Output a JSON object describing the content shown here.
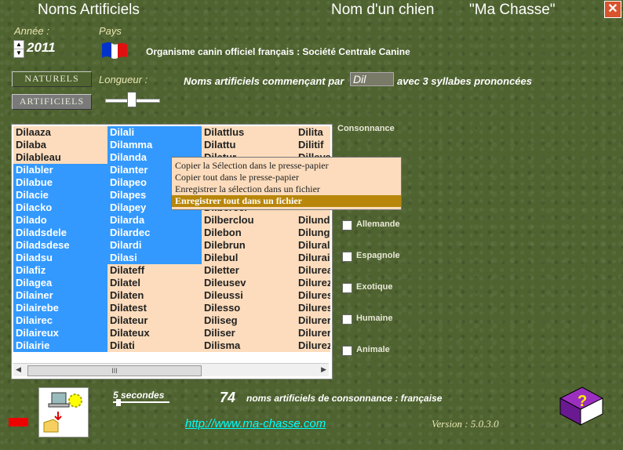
{
  "title": {
    "app": "Noms Artificiels",
    "subtitle": "Nom d'un chien",
    "brand": "\"Ma Chasse\""
  },
  "annee": {
    "label": "Année :",
    "value": "2011"
  },
  "pays": {
    "label": "Pays",
    "organisme": "Organisme canin officiel français : Société Centrale Canine"
  },
  "buttons": {
    "naturels": "NATURELS",
    "artificiels": "ARTIFICIELS"
  },
  "longueur": {
    "label": "Longueur :"
  },
  "search": {
    "prefix_label": "Noms artificiels commençant par",
    "prefix_value": "Dil",
    "suffix_label": "avec 3 syllabes prononcées"
  },
  "list": {
    "col1": [
      "Dilaaza",
      "Dilaba",
      "Dilableau",
      "Dilabler",
      "Dilabue",
      "Dilacie",
      "Dilacko",
      "Dilado",
      "Diladsdele",
      "Diladsdese",
      "Diladsu",
      "Dilafiz",
      "Dilagea",
      "Dilainer",
      "Dilairebe",
      "Dilairec",
      "Dilaireux",
      "Dilairie"
    ],
    "col2": [
      "Dilali",
      "Dilamma",
      "Dilanda",
      "Dilanter",
      "Dilapeo",
      "Dilapes",
      "Dilapey",
      "Dilarda",
      "Dilardec",
      "Dilardi",
      "Dilasi",
      "Dilateff",
      "Dilatel",
      "Dilaten",
      "Dilatest",
      "Dilateur",
      "Dilateux",
      "Dilati"
    ],
    "col3": [
      "Dilattlus",
      "Dilattu",
      "Dilatur",
      "",
      "",
      "",
      "",
      "Dilberclou",
      "Dilebon",
      "Dilebrun",
      "Dilebul",
      "Diletter",
      "Dileusev",
      "Dileussi",
      "Dilesso",
      "Diliseg",
      "Diliser",
      "Dilisma"
    ],
    "col4": [
      "Dilita",
      "Dilitif",
      "Dilleys",
      "",
      "",
      "",
      "",
      "Dilund",
      "Dilung",
      "Dilural",
      "Dilurai",
      "Dilurea",
      "Dilurez",
      "Dilures",
      "Dilures",
      "Dilurer",
      "Dilurer",
      "Dilurez"
    ],
    "col3_partial": "Dilbercer"
  },
  "context_menu": [
    "Copier la Sélection dans le presse-papier",
    "Copier tout dans le presse-papier",
    "Enregistrer la sélection dans un fichier",
    "Enregistrer tout dans un fichier"
  ],
  "consonance": {
    "label": "Consonnance",
    "options": [
      "Allemande",
      "Espagnole",
      "Exotique",
      "Humaine",
      "Animale"
    ]
  },
  "footer": {
    "delay": "5 secondes",
    "count": "74",
    "count_label": "noms artificiels de consonnance : française",
    "url": "http://www.ma-chasse.com",
    "version": "Version : 5.0.3.0"
  },
  "scroll_thumb": "III",
  "colors": {
    "selected": "#3399ff",
    "unselected": "#fcdcbc",
    "menu_highlight": "#b8860b"
  }
}
